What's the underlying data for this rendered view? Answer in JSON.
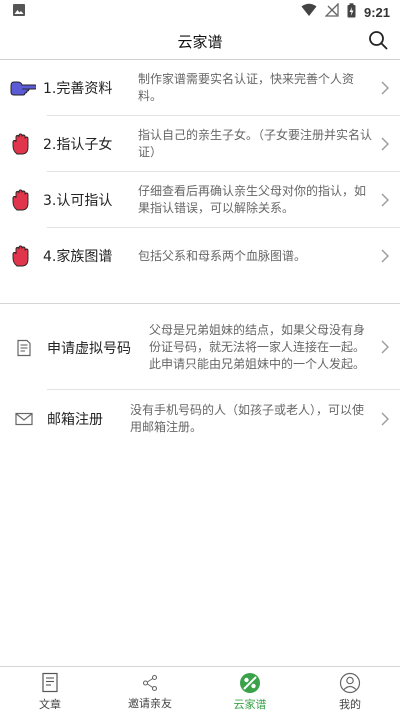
{
  "status_bar": {
    "time": "9:21",
    "icons": [
      "image-icon",
      "wifi-icon",
      "no-signal-icon",
      "battery-charging-icon"
    ]
  },
  "header": {
    "title": "云家谱",
    "search_icon": "search-icon"
  },
  "steps": [
    {
      "title": "1.完善资料",
      "desc": "制作家谱需要实名认证，快来完善个人资料。",
      "icon": "pointing-hand-icon",
      "icon_color": "#5b5bd6"
    },
    {
      "title": "2.指认子女",
      "desc": "指认自己的亲生子女。（子女要注册并实名认证）",
      "icon": "raised-hand-icon",
      "icon_color": "#e0354a"
    },
    {
      "title": "3.认可指认",
      "desc": "仔细查看后再确认亲生父母对你的指认，如果指认错误，可以解除关系。",
      "icon": "raised-hand-icon",
      "icon_color": "#e0354a"
    },
    {
      "title": "4.家族图谱",
      "desc": "包括父系和母系两个血脉图谱。",
      "icon": "raised-hand-icon",
      "icon_color": "#e0354a"
    }
  ],
  "extras": [
    {
      "title": "申请虚拟号码",
      "desc": "父母是兄弟姐妹的结点，如果父母没有身份证号码，就无法将一家人连接在一起。此申请只能由兄弟姐妹中的一个人发起。",
      "icon": "document-icon"
    },
    {
      "title": "邮箱注册",
      "desc": "没有手机号码的人（如孩子或老人），可以使用邮箱注册。",
      "icon": "mail-icon"
    }
  ],
  "tabs": [
    {
      "label": "文章",
      "icon": "article-icon",
      "active": false
    },
    {
      "label": "邀请亲友",
      "icon": "share-icon",
      "active": false
    },
    {
      "label": "云家谱",
      "icon": "family-tree-icon",
      "active": true
    },
    {
      "label": "我的",
      "icon": "profile-icon",
      "active": false
    }
  ],
  "colors": {
    "accent": "#3aa34a",
    "pointer_hand": "#5b5bd6",
    "stop_hand": "#e0354a",
    "divider": "#e3e3e3"
  }
}
